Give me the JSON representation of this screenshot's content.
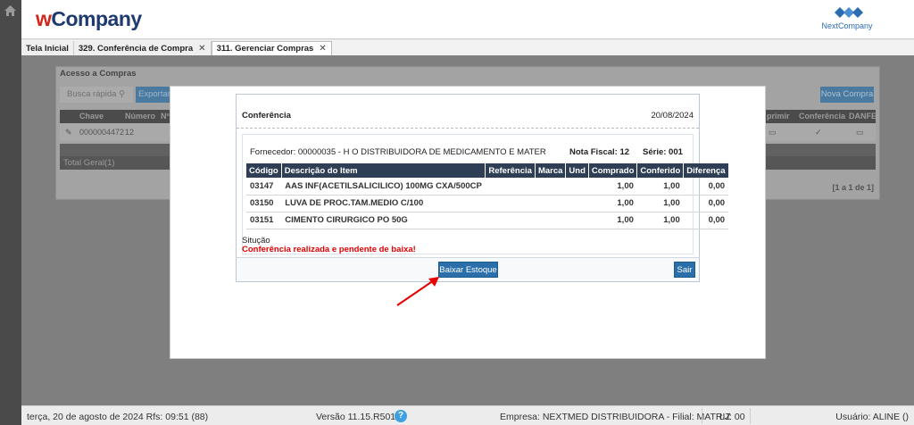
{
  "header": {
    "logo_w": "w",
    "logo_rest": "Company",
    "partner_logo": "NextCompany"
  },
  "tabs": [
    {
      "label": "Tela Inicial",
      "closable": false
    },
    {
      "label": "329. Conferência de Compra",
      "closable": true
    },
    {
      "label": "311. Gerenciar Compras",
      "closable": true,
      "active": true
    }
  ],
  "background": {
    "panel_title": "Acesso a Compras",
    "quick_search": "Busca rápida",
    "export_label": "Exportar",
    "new_button": "Nova Compra",
    "columns": [
      "Chave",
      "Número",
      "Nº",
      "primir",
      "Conferência",
      "DANFE"
    ],
    "row": {
      "chave": "0000004472",
      "numero": "12"
    },
    "total": "Total Geral(1)",
    "pager": "[1 a 1 de 1]"
  },
  "modal": {
    "title": "Conferência",
    "date": "20/08/2024",
    "fornecedor": "Fornecedor: 00000035 - H O DISTRIBUIDORA DE MEDICAMENTO E MATER",
    "nota_fiscal": "Nota Fiscal: 12",
    "serie": "Série: 001",
    "columns": [
      "Código",
      "Descrição do Item",
      "Referência",
      "Marca",
      "Und",
      "Comprado",
      "Conferido",
      "Diferença"
    ],
    "rows": [
      {
        "codigo": "03147",
        "descricao": "AAS INF(ACETILSALICILICO) 100MG CXA/500CP",
        "referencia": "",
        "marca": "",
        "und": "",
        "comprado": "1,00",
        "conferido": "1,00",
        "diferenca": "0,00"
      },
      {
        "codigo": "03150",
        "descricao": "LUVA DE PROC.TAM.MEDIO C/100",
        "referencia": "",
        "marca": "",
        "und": "",
        "comprado": "1,00",
        "conferido": "1,00",
        "diferenca": "0,00"
      },
      {
        "codigo": "03151",
        "descricao": "CIMENTO CIRURGICO PO 50G",
        "referencia": "",
        "marca": "",
        "und": "",
        "comprado": "1,00",
        "conferido": "1,00",
        "diferenca": "0,00"
      }
    ],
    "situacao_label": "Situção",
    "situacao_text": "Conferência realizada e pendente de baixa!",
    "btn_baixar": "Baixar Estoque",
    "btn_sair": "Sair"
  },
  "statusbar": {
    "date": "terça, 20 de agosto de 2024  Rfs: 09:51 (88)",
    "version": "Versão 11.15.R5017",
    "help": "?",
    "empresa": "Empresa: NEXTMED DISTRIBUIDORA - Filial: MATRIZ",
    "loja": "LJ: 00",
    "usuario": "Usuário: ALINE ()"
  },
  "colors": {
    "accent_blue": "#2a6faa",
    "table_header": "#2e3e55",
    "warning_red": "#e00000",
    "logo_red": "#d0261b",
    "logo_navy": "#1e3a6e"
  }
}
